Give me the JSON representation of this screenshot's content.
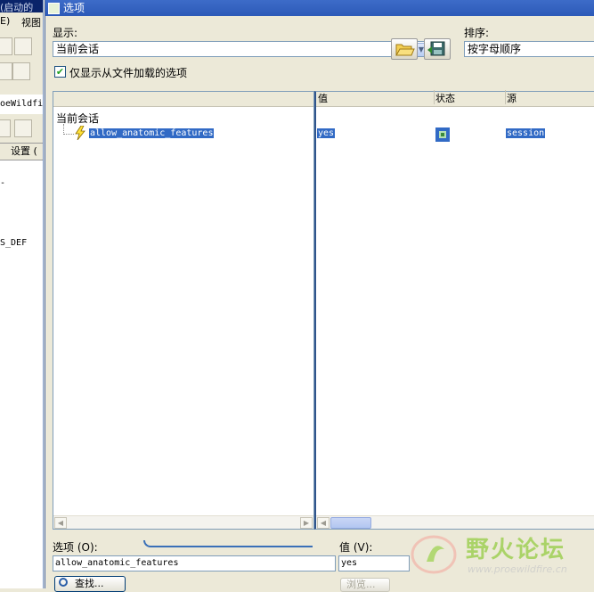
{
  "background_window": {
    "title_fragment": "(启动的",
    "menu_labels": [
      "E)",
      "视图"
    ],
    "path_fragment": "oeWildfi",
    "settings_label": "设置 (",
    "tree_fragment": "S_DEF"
  },
  "dialog": {
    "title": "选项",
    "display_label": "显示:",
    "display_value": "当前会话",
    "sort_label": "排序:",
    "sort_value": "按字母顺序",
    "checkbox_label": "仅显示从文件加载的选项",
    "checkbox_checked": true
  },
  "tree": {
    "root_label": "当前会话",
    "items": [
      {
        "name": "allow_anatomic_features"
      }
    ]
  },
  "columns": {
    "value": "值",
    "status": "状态",
    "source": "源"
  },
  "rows": [
    {
      "value": "yes",
      "source": "session"
    }
  ],
  "bottom": {
    "option_label": "选项 (O):",
    "option_value": "allow_anatomic_features",
    "value_label": "值 (V):",
    "value_value": "yes",
    "find_button": "查找...",
    "browse_button": "浏览..."
  },
  "watermark": {
    "brand": "野火论坛",
    "url": "www.proewildfire.cn"
  },
  "colors": {
    "selection": "#316ac5",
    "title_bar": "#2c5ab8",
    "dialog_bg": "#ece9d8"
  }
}
